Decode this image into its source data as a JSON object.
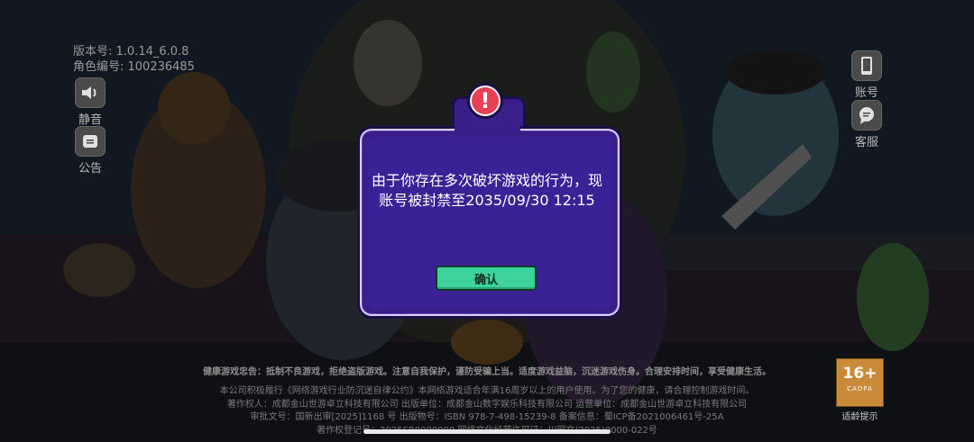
{
  "top_info": {
    "version": "版本号: 1.0.14_6.0.8",
    "role_id": "角色编号: 100236485"
  },
  "side_buttons": {
    "mute": "静音",
    "notice": "公告",
    "account": "账号",
    "service": "客服"
  },
  "modal": {
    "message_line1": "由于你存在多次破坏游戏的行为，现",
    "message_line2": "账号被封禁至2035/09/30 12:15",
    "confirm": "确认",
    "alert_symbol": "!"
  },
  "footer": {
    "health_advice": "健康游戏忠告：抵制不良游戏，拒绝盗版游戏。注意自我保护，谨防受骗上当。适度游戏益脑，沉迷游戏伤身。合理安排时间，享受健康生活。",
    "line1": "本公司积极履行《网络游戏行业防沉迷自律公约》本网络游戏适合年满16周岁以上的用户使用。为了您的健康，请合理控制游戏时间。",
    "line2": "著作权人：成都金山世游卓立科技有限公司 出版单位：成都金山数字娱乐科技有限公司 运营单位：成都金山世游卓立科技有限公司",
    "line3": "审批文号：国新出审[2025]1168 号 出版物号：ISBN 978-7-498-15239-8 备案信息：蜀ICP备2021006461号-25A",
    "line4": "著作权登记号：2025SR0000000 网络文化经营许可证：川网文(2025)0000-022号",
    "age_rating": "16+",
    "age_org": "CADPA",
    "age_tip": "适龄提示"
  },
  "colors": {
    "modal_bg": "#3a1f8a",
    "confirm_bg": "#3ed39a",
    "alert_red": "#e84155"
  }
}
